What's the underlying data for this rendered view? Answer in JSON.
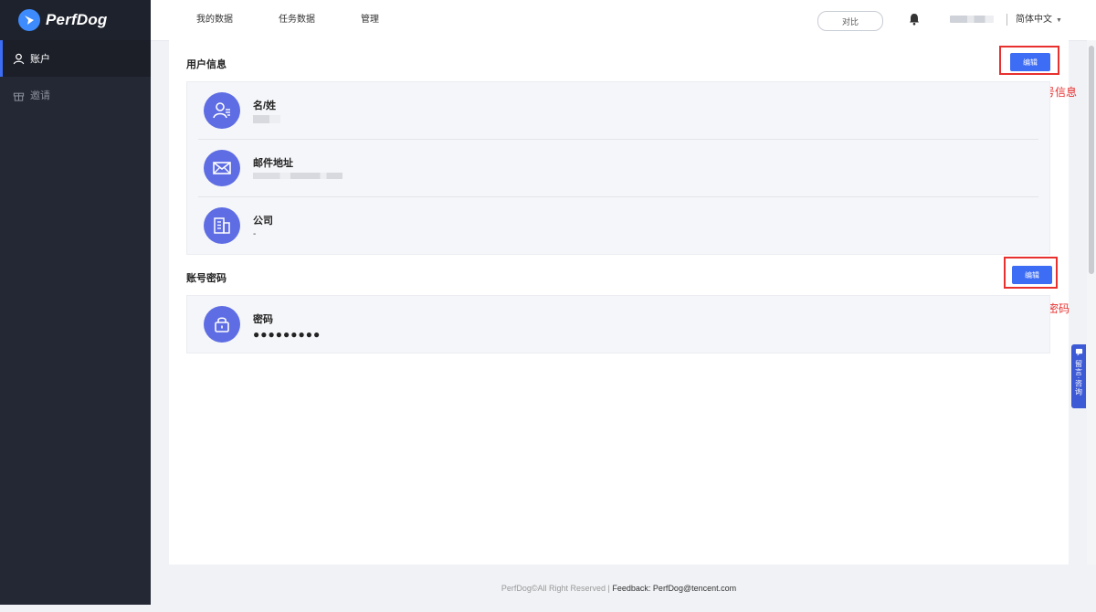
{
  "brand": {
    "name": "PerfDog"
  },
  "sidebar": {
    "items": [
      {
        "label": "账户",
        "active": true,
        "icon": "user-icon"
      },
      {
        "label": "邀请",
        "active": false,
        "icon": "gift-icon"
      }
    ]
  },
  "topbar": {
    "tabs": [
      "我的数据",
      "任务数据",
      "管理"
    ],
    "compare_label": "对比",
    "language": "简体中文"
  },
  "user_info": {
    "title": "用户信息",
    "edit_label": "编辑",
    "annotation": "点击后，可编辑账号信息",
    "rows": [
      {
        "label": "名/姓",
        "icon": "user-card-icon"
      },
      {
        "label": "邮件地址",
        "icon": "mail-icon"
      },
      {
        "label": "公司",
        "value": "-",
        "icon": "building-icon"
      }
    ]
  },
  "account_password": {
    "title": "账号密码",
    "edit_label": "编辑",
    "annotation": "点击后，可重置密码",
    "rows": [
      {
        "label": "密码",
        "value": "●●●●●●●●●",
        "icon": "lock-icon"
      }
    ]
  },
  "feedback_tab": {
    "label": "留言·咨询"
  },
  "footer": {
    "copyright": "PerfDog©All Right Reserved | ",
    "feedback": "Feedback: PerfDog@tencent.com"
  },
  "colors": {
    "sidebar_bg": "#242834",
    "accent": "#3d6cf5",
    "avatar_bg": "#5e6de3",
    "annotation_red": "#e8302f"
  }
}
